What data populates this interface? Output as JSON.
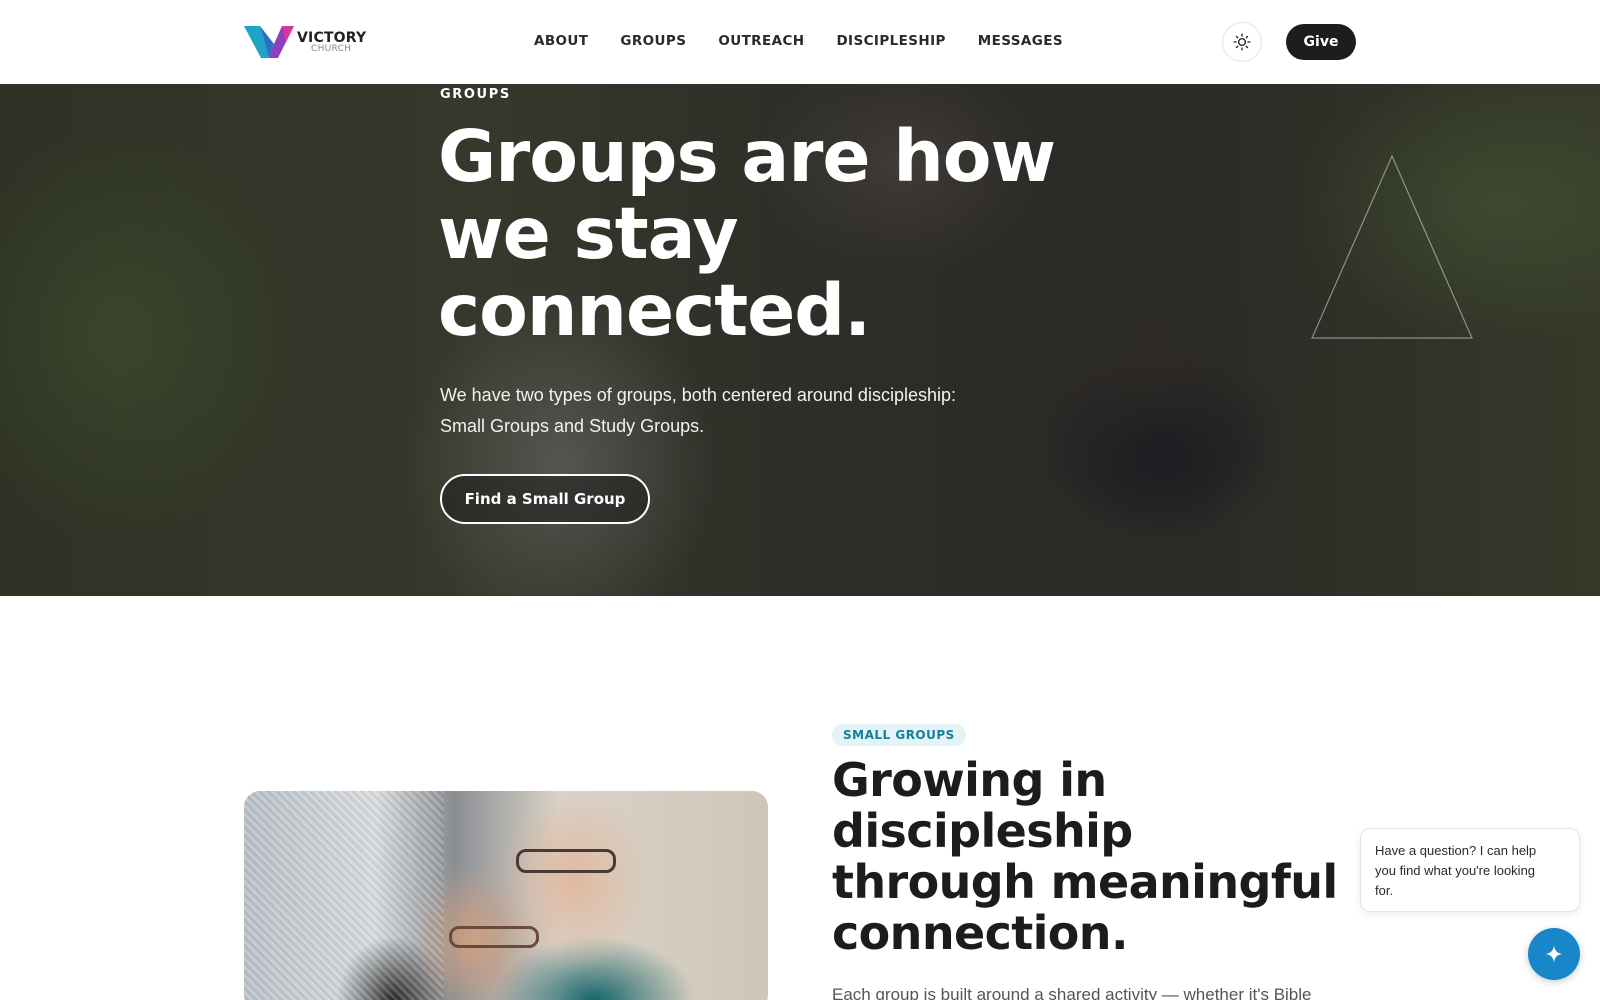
{
  "brand": {
    "name": "VICTORY",
    "sub": "CHURCH",
    "colors": {
      "logo_left": "#1fa3c8",
      "logo_right": "#8e3fbd",
      "logo_mid": "#d4389a"
    }
  },
  "nav": {
    "items": [
      {
        "label": "ABOUT"
      },
      {
        "label": "GROUPS"
      },
      {
        "label": "OUTREACH"
      },
      {
        "label": "DISCIPLESHIP"
      },
      {
        "label": "MESSAGES"
      }
    ],
    "theme_icon": "sun-icon",
    "give_label": "Give"
  },
  "hero": {
    "eyebrow": "GROUPS",
    "title_lines": [
      "Groups are how",
      "we stay",
      "connected."
    ],
    "description_lines": [
      "We have two types of groups, both centered around discipleship:",
      "Small Groups and Study Groups."
    ],
    "cta_label": "Find a Small Group"
  },
  "small_groups": {
    "pill": "SMALL GROUPS",
    "title_lines": [
      "Growing in",
      "discipleship",
      "through meaningful",
      "connection."
    ],
    "description": "Each group is built around a shared activity — whether it's Bible"
  },
  "chat": {
    "message_lines": [
      "Have a question? I can help",
      "you find what you're looking",
      "for."
    ],
    "button_icon": "sparkle-icon",
    "accent": "#1787c9"
  }
}
